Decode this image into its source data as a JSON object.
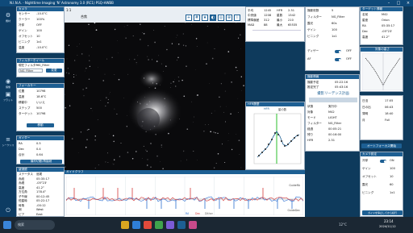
{
  "app": {
    "title": "N.I.N.A. - Nighttime Imaging 'N' Astronomy 3.0 (RC1)  PSQ-HWBB"
  },
  "nav": {
    "items": [
      "機材",
      "撮像",
      "フラット",
      "シーケンス",
      "オプション"
    ]
  },
  "left": {
    "camera_header": "カメラ",
    "camera_rows": [
      [
        "センサー",
        "-10.0°C"
      ],
      [
        "クーラー",
        "100%"
      ],
      [
        "冷却",
        "OFF"
      ],
      [
        "ゲイン",
        "100"
      ],
      [
        "オフセット",
        "10"
      ],
      [
        "ビニング",
        "1x1"
      ],
      [
        "温度",
        "-10.0°C"
      ]
    ],
    "filter_header": "フィルターホイール",
    "filter_row": [
      "現在フィルター",
      "NG_Filter"
    ],
    "filter_select": "NG_Filter",
    "filter_button": "変更",
    "focus_header": "フォーカサー",
    "focus_rows": [
      [
        "位置",
        "10798"
      ],
      [
        "温度",
        "18.6°C"
      ],
      [
        "移動中",
        "いいえ"
      ],
      [
        "ステップ",
        "500"
      ],
      [
        "ターゲット",
        "10798"
      ]
    ],
    "focus_button": "移動",
    "guider_header": "ガイダー",
    "guider_rows": [
      [
        "RA",
        "0.5"
      ],
      [
        "Dec",
        "0.4"
      ],
      [
        "合計",
        "0.64"
      ]
    ],
    "guider_button": "機材切断/再接続",
    "telescope_header": "望遠鏡",
    "telescope_rows": [
      [
        "ステータス",
        "追尾"
      ],
      [
        "赤経",
        "05:35:17"
      ],
      [
        "赤緯",
        "-05°23'"
      ],
      [
        "高度",
        "41.2°"
      ],
      [
        "方位角",
        "178.4°"
      ],
      [
        "子午線",
        "00:12:45"
      ],
      [
        "恒星時",
        "05:22:17"
      ],
      [
        "時角",
        "-00:12"
      ],
      [
        "側",
        "West"
      ],
      [
        "ピア",
        "East"
      ]
    ]
  },
  "toolbar": {
    "zoom": "1:1",
    "label": "合焦",
    "extra": "情報"
  },
  "stats": {
    "cols": [
      [
        "平均",
        "1245"
      ],
      [
        "中央値",
        "1208"
      ],
      [
        "標準偏差",
        "312"
      ],
      [
        "MAD",
        "88"
      ]
    ],
    "cols2": [
      [
        "HFR",
        "2.31"
      ],
      [
        "星数",
        "1342"
      ],
      [
        "最小",
        "210"
      ],
      [
        "最大",
        "65535"
      ]
    ]
  },
  "hfr": {
    "header": "HFR履歴",
    "legend": [
      "HFR",
      "星の数"
    ]
  },
  "seq": {
    "header": "シーケンス",
    "rows": [
      [
        "撮影枚数",
        "5"
      ],
      [
        "フィルター",
        "NG_Filter"
      ],
      [
        "露光",
        "60s"
      ],
      [
        "ゲイン",
        "100"
      ],
      [
        "ビニング",
        "1x1"
      ]
    ],
    "dither": [
      "ディザー",
      "OFF"
    ],
    "autofocus": [
      "AF",
      "OFF"
    ],
    "info_header": "撮影情報",
    "info_rows": [
      [
        "撮影予定",
        "05:22:16"
      ],
      [
        "推定完了",
        "05:43:16"
      ]
    ],
    "title": "撮影リーデンス計画",
    "detail_rows": [
      [
        "状態",
        "実行中"
      ],
      [
        "対象",
        "M42"
      ],
      [
        "モード",
        "LIGHT"
      ],
      [
        "フィルター",
        "NG_Filter"
      ],
      [
        "経過",
        "00:05:21"
      ],
      [
        "残り",
        "00:16:00"
      ],
      [
        "HFR",
        "2.31"
      ]
    ]
  },
  "right": {
    "header": "ターゲット情報",
    "rows": [
      [
        "名前",
        "M42"
      ],
      [
        "星座",
        "Orion"
      ],
      [
        "RA",
        "05:35:17"
      ],
      [
        "Dec",
        "-05°23'"
      ],
      [
        "高度",
        "41.2°"
      ]
    ],
    "altitude_header": "対象の高さ",
    "twilight_rows": [
      [
        "日没",
        "17:05"
      ],
      [
        "日の出",
        "06:43"
      ],
      [
        "薄明",
        "18:40"
      ],
      [
        "月",
        "Full"
      ]
    ],
    "af_button": "オートフォーカス開始",
    "cam_header": "カメラ設定",
    "cam_rows": [
      [
        "冷却",
        "ON"
      ],
      [
        "ゲイン",
        "100"
      ],
      [
        "オフセット",
        "10"
      ],
      [
        "露光",
        "60"
      ],
      [
        "ビニング",
        "1x1"
      ]
    ],
    "bottom_button": "ガイドを停止してから続行"
  },
  "plot": {
    "header": "ガイドグラフ",
    "legend": [
      "RA",
      "Dec",
      "Dither"
    ],
    "label_right": "GuideRA",
    "label_right2": "GuideDec"
  },
  "taskbar": {
    "search": "検索",
    "time": "23:14",
    "date": "2024/11/12",
    "temp": "12°C"
  }
}
